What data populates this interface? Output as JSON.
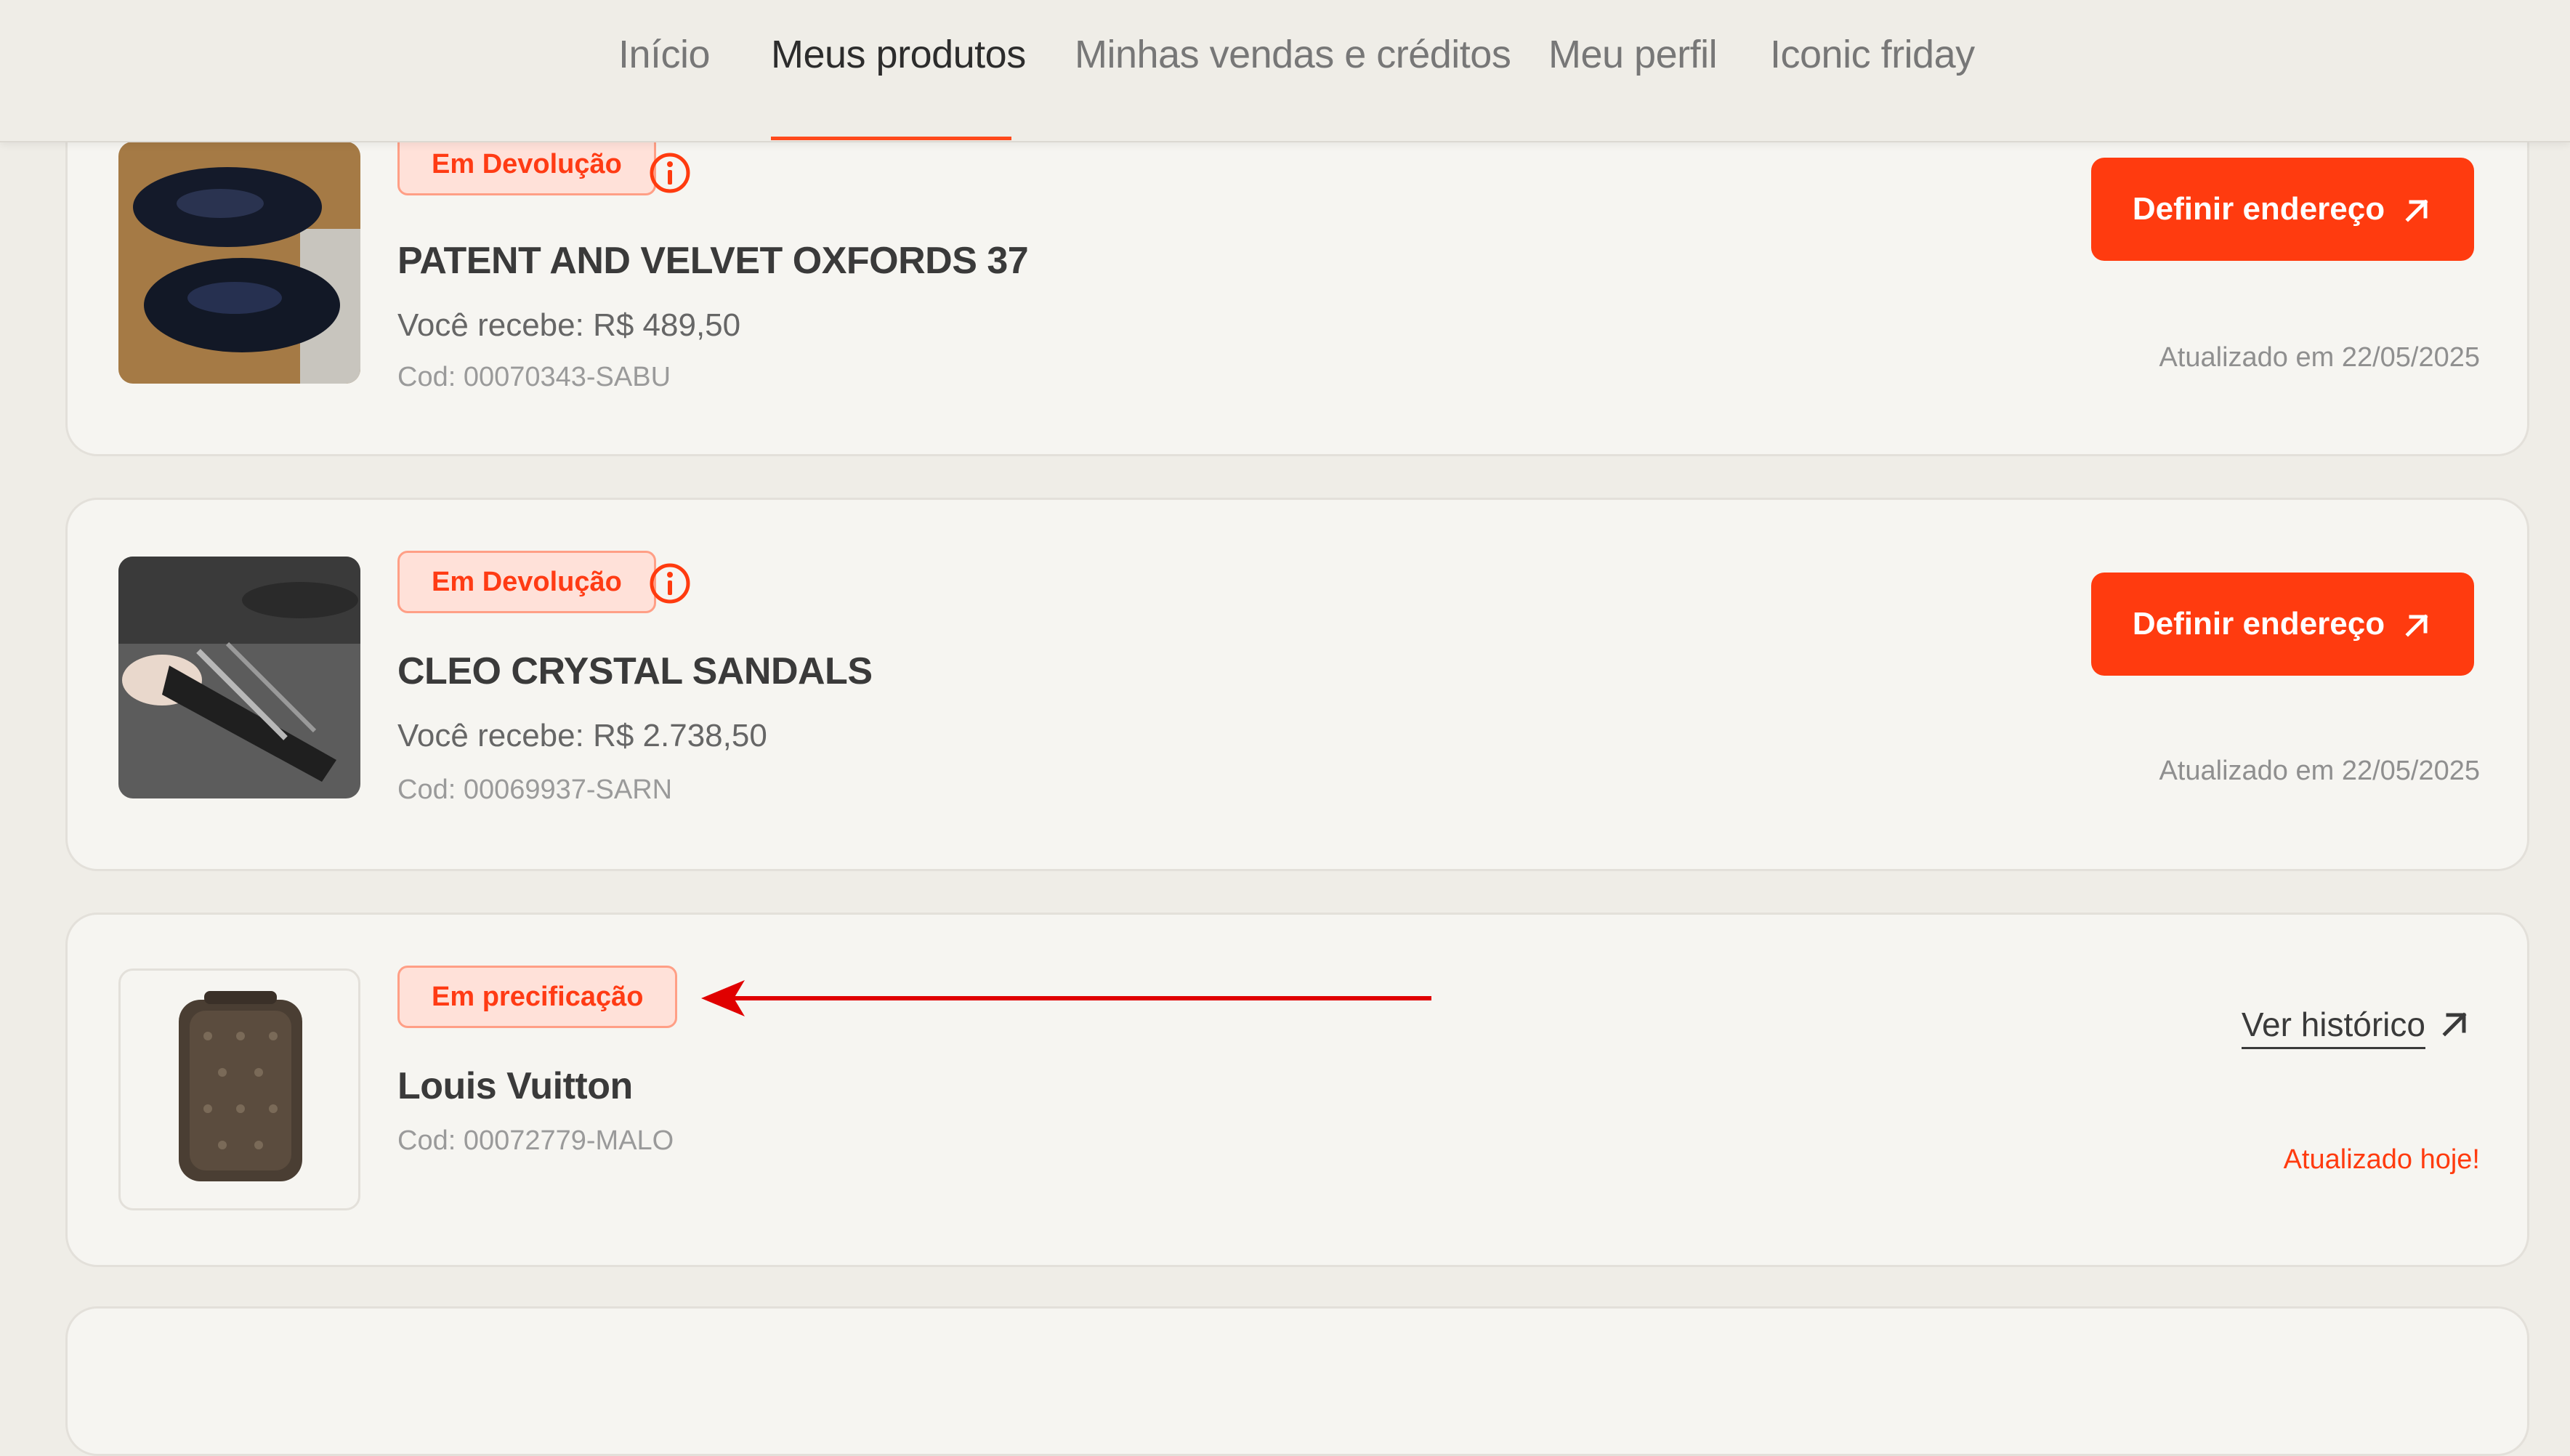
{
  "nav": {
    "tabs": [
      {
        "label": "Início"
      },
      {
        "label": "Meus produtos"
      },
      {
        "label": "Minhas vendas e créditos"
      },
      {
        "label": "Meu perfil"
      },
      {
        "label": "Iconic friday"
      }
    ],
    "active_tab": "Meus produtos"
  },
  "products": [
    {
      "status": "Em Devolução",
      "name": "PATENT AND VELVET OXFORDS 37",
      "receive": "Você recebe: R$ 489,50",
      "code": "Cod: 00070343-SABU",
      "action": "Definir endereço",
      "updated": "Atualizado em 22/05/2025"
    },
    {
      "status": "Em Devolução",
      "name": "CLEO CRYSTAL SANDALS",
      "receive": "Você recebe: R$ 2.738,50",
      "code": "Cod: 00069937-SARN",
      "action": "Definir endereço",
      "updated": "Atualizado em 22/05/2025"
    },
    {
      "status": "Em precificação",
      "name": "Louis Vuitton",
      "code": "Cod: 00072779-MALO",
      "action": "Ver histórico",
      "updated": "Atualizado hoje!"
    }
  ],
  "colors": {
    "accent": "#ff3b0f",
    "badge_bg": "#ffe1d9",
    "background": "#efede7",
    "annotation_arrow": "#e00000"
  },
  "icons": [
    "info-icon",
    "arrow-up-right-icon"
  ]
}
